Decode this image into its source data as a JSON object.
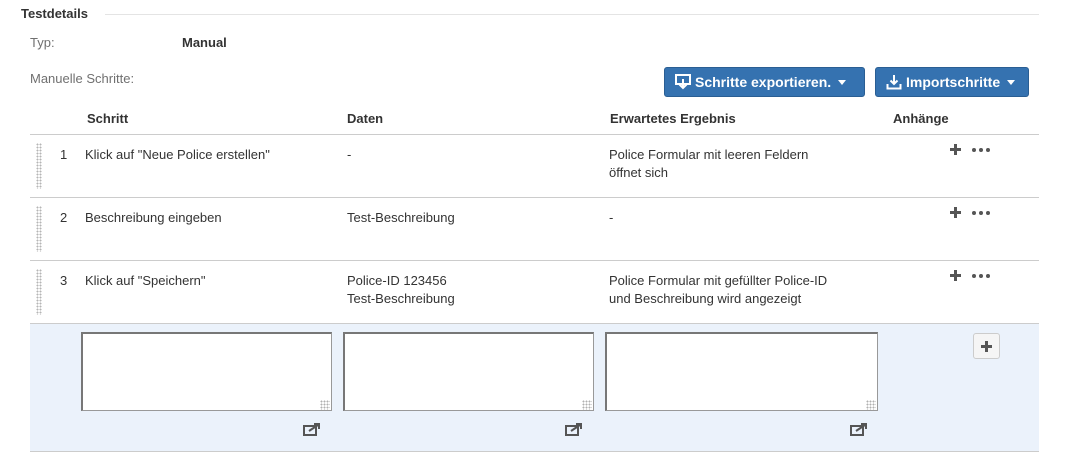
{
  "section": {
    "title": "Testdetails"
  },
  "meta": {
    "type_label": "Typ:",
    "type_value": "Manual",
    "steps_label": "Manuelle Schritte:"
  },
  "toolbar": {
    "export_label": "Schritte exportieren.",
    "import_label": "Importschritte",
    "button_color": "#3572b0"
  },
  "table": {
    "headers": {
      "step": "Schritt",
      "data": "Daten",
      "expected": "Erwartetes Ergebnis",
      "attachments": "Anhänge"
    },
    "rows": [
      {
        "num": "1",
        "step": "Klick auf \"Neue Police erstellen\"",
        "data": [
          "-"
        ],
        "expected": [
          "Police Formular mit leeren Feldern",
          "öffnet sich"
        ]
      },
      {
        "num": "2",
        "step": "Beschreibung eingeben",
        "data": [
          "Test-Beschreibung"
        ],
        "expected": [
          "-"
        ]
      },
      {
        "num": "3",
        "step": "Klick auf \"Speichern\"",
        "data": [
          "Police-ID 123456",
          "Test-Beschreibung"
        ],
        "expected": [
          "Police Formular mit gefüllter Police-ID",
          "und Beschreibung wird angezeigt"
        ]
      }
    ]
  },
  "new_step": {
    "step_value": "",
    "data_value": "",
    "expected_value": "",
    "row_color": "#ebf2fb"
  },
  "icons": {
    "export": "export-download-icon",
    "import": "import-download-icon",
    "add": "plus-icon",
    "more": "more-dots-icon",
    "share": "share-icon",
    "drag": "drag-handle-icon"
  }
}
